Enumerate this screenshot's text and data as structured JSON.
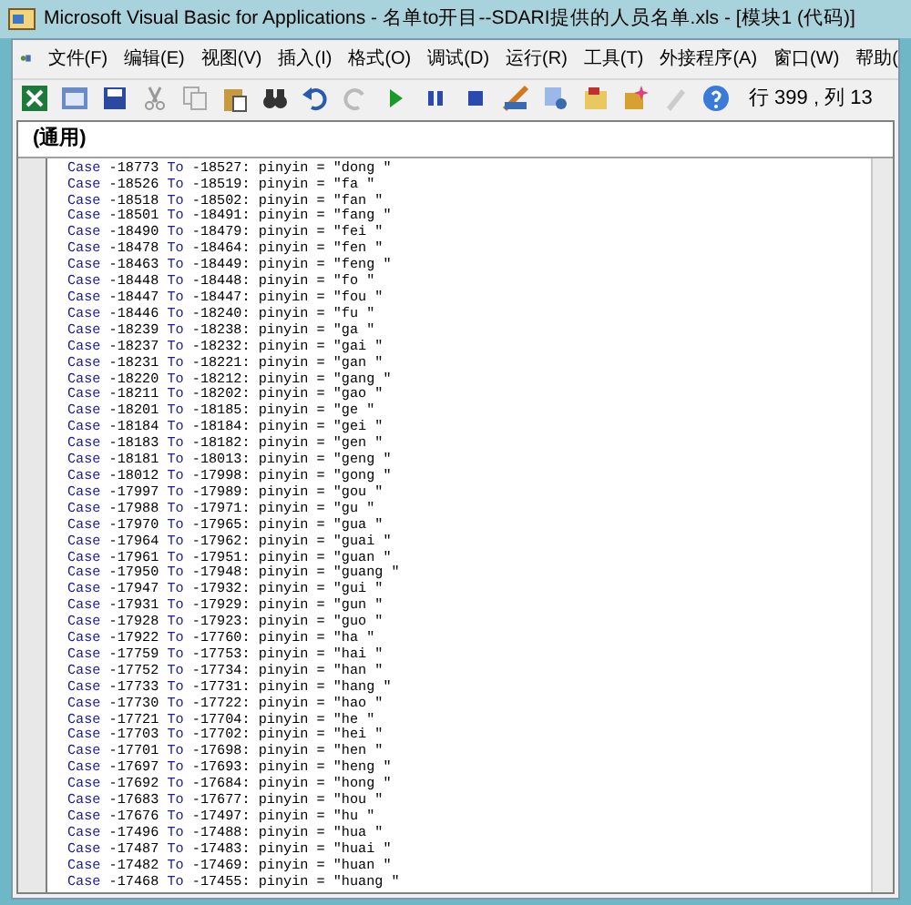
{
  "window": {
    "title": "Microsoft Visual Basic for Applications - 名单to开目--SDARI提供的人员名单.xls - [模块1 (代码)]"
  },
  "menu": [
    "文件(F)",
    "编辑(E)",
    "视图(V)",
    "插入(I)",
    "格式(O)",
    "调试(D)",
    "运行(R)",
    "工具(T)",
    "外接程序(A)",
    "窗口(W)",
    "帮助("
  ],
  "toolbar": {
    "position": "行 399 , 列 13"
  },
  "object_dropdown": {
    "value": "(通用)"
  },
  "code_lines": [
    {
      "keyword": "Case",
      "from": "-18773",
      "keyword_2": "To",
      "to": "-18527:",
      "rest": "pinyin = \"dong \""
    },
    {
      "keyword": "Case",
      "from": "-18526",
      "keyword_2": "To",
      "to": "-18519:",
      "rest": "pinyin = \"fa \""
    },
    {
      "keyword": "Case",
      "from": "-18518",
      "keyword_2": "To",
      "to": "-18502:",
      "rest": "pinyin = \"fan \""
    },
    {
      "keyword": "Case",
      "from": "-18501",
      "keyword_2": "To",
      "to": "-18491:",
      "rest": "pinyin = \"fang \""
    },
    {
      "keyword": "Case",
      "from": "-18490",
      "keyword_2": "To",
      "to": "-18479:",
      "rest": "pinyin = \"fei \""
    },
    {
      "keyword": "Case",
      "from": "-18478",
      "keyword_2": "To",
      "to": "-18464:",
      "rest": "pinyin = \"fen \""
    },
    {
      "keyword": "Case",
      "from": "-18463",
      "keyword_2": "To",
      "to": "-18449:",
      "rest": "pinyin = \"feng \""
    },
    {
      "keyword": "Case",
      "from": "-18448",
      "keyword_2": "To",
      "to": "-18448:",
      "rest": "pinyin = \"fo \""
    },
    {
      "keyword": "Case",
      "from": "-18447",
      "keyword_2": "To",
      "to": "-18447:",
      "rest": "pinyin = \"fou \""
    },
    {
      "keyword": "Case",
      "from": "-18446",
      "keyword_2": "To",
      "to": "-18240:",
      "rest": "pinyin = \"fu \""
    },
    {
      "keyword": "Case",
      "from": "-18239",
      "keyword_2": "To",
      "to": "-18238:",
      "rest": "pinyin = \"ga \""
    },
    {
      "keyword": "Case",
      "from": "-18237",
      "keyword_2": "To",
      "to": "-18232:",
      "rest": "pinyin = \"gai \""
    },
    {
      "keyword": "Case",
      "from": "-18231",
      "keyword_2": "To",
      "to": "-18221:",
      "rest": "pinyin = \"gan \""
    },
    {
      "keyword": "Case",
      "from": "-18220",
      "keyword_2": "To",
      "to": "-18212:",
      "rest": "pinyin = \"gang \""
    },
    {
      "keyword": "Case",
      "from": "-18211",
      "keyword_2": "To",
      "to": "-18202:",
      "rest": "pinyin = \"gao \""
    },
    {
      "keyword": "Case",
      "from": "-18201",
      "keyword_2": "To",
      "to": "-18185:",
      "rest": "pinyin = \"ge \""
    },
    {
      "keyword": "Case",
      "from": "-18184",
      "keyword_2": "To",
      "to": "-18184:",
      "rest": "pinyin = \"gei \""
    },
    {
      "keyword": "Case",
      "from": "-18183",
      "keyword_2": "To",
      "to": "-18182:",
      "rest": "pinyin = \"gen \""
    },
    {
      "keyword": "Case",
      "from": "-18181",
      "keyword_2": "To",
      "to": "-18013:",
      "rest": "pinyin = \"geng \""
    },
    {
      "keyword": "Case",
      "from": "-18012",
      "keyword_2": "To",
      "to": "-17998:",
      "rest": "pinyin = \"gong \""
    },
    {
      "keyword": "Case",
      "from": "-17997",
      "keyword_2": "To",
      "to": "-17989:",
      "rest": "pinyin = \"gou \""
    },
    {
      "keyword": "Case",
      "from": "-17988",
      "keyword_2": "To",
      "to": "-17971:",
      "rest": "pinyin = \"gu \""
    },
    {
      "keyword": "Case",
      "from": "-17970",
      "keyword_2": "To",
      "to": "-17965:",
      "rest": "pinyin = \"gua \""
    },
    {
      "keyword": "Case",
      "from": "-17964",
      "keyword_2": "To",
      "to": "-17962:",
      "rest": "pinyin = \"guai \""
    },
    {
      "keyword": "Case",
      "from": "-17961",
      "keyword_2": "To",
      "to": "-17951:",
      "rest": "pinyin = \"guan \""
    },
    {
      "keyword": "Case",
      "from": "-17950",
      "keyword_2": "To",
      "to": "-17948:",
      "rest": "pinyin = \"guang \""
    },
    {
      "keyword": "Case",
      "from": "-17947",
      "keyword_2": "To",
      "to": "-17932:",
      "rest": "pinyin = \"gui \""
    },
    {
      "keyword": "Case",
      "from": "-17931",
      "keyword_2": "To",
      "to": "-17929:",
      "rest": "pinyin = \"gun \""
    },
    {
      "keyword": "Case",
      "from": "-17928",
      "keyword_2": "To",
      "to": "-17923:",
      "rest": "pinyin = \"guo \""
    },
    {
      "keyword": "Case",
      "from": "-17922",
      "keyword_2": "To",
      "to": "-17760:",
      "rest": "pinyin = \"ha \""
    },
    {
      "keyword": "Case",
      "from": "-17759",
      "keyword_2": "To",
      "to": "-17753:",
      "rest": "pinyin = \"hai \""
    },
    {
      "keyword": "Case",
      "from": "-17752",
      "keyword_2": "To",
      "to": "-17734:",
      "rest": "pinyin = \"han \""
    },
    {
      "keyword": "Case",
      "from": "-17733",
      "keyword_2": "To",
      "to": "-17731:",
      "rest": "pinyin = \"hang \""
    },
    {
      "keyword": "Case",
      "from": "-17730",
      "keyword_2": "To",
      "to": "-17722:",
      "rest": "pinyin = \"hao \""
    },
    {
      "keyword": "Case",
      "from": "-17721",
      "keyword_2": "To",
      "to": "-17704:",
      "rest": "pinyin = \"he \""
    },
    {
      "keyword": "Case",
      "from": "-17703",
      "keyword_2": "To",
      "to": "-17702:",
      "rest": "pinyin = \"hei \""
    },
    {
      "keyword": "Case",
      "from": "-17701",
      "keyword_2": "To",
      "to": "-17698:",
      "rest": "pinyin = \"hen \""
    },
    {
      "keyword": "Case",
      "from": "-17697",
      "keyword_2": "To",
      "to": "-17693:",
      "rest": "pinyin = \"heng \""
    },
    {
      "keyword": "Case",
      "from": "-17692",
      "keyword_2": "To",
      "to": "-17684:",
      "rest": "pinyin = \"hong \""
    },
    {
      "keyword": "Case",
      "from": "-17683",
      "keyword_2": "To",
      "to": "-17677:",
      "rest": "pinyin = \"hou \""
    },
    {
      "keyword": "Case",
      "from": "-17676",
      "keyword_2": "To",
      "to": "-17497:",
      "rest": "pinyin = \"hu \""
    },
    {
      "keyword": "Case",
      "from": "-17496",
      "keyword_2": "To",
      "to": "-17488:",
      "rest": "pinyin = \"hua \""
    },
    {
      "keyword": "Case",
      "from": "-17487",
      "keyword_2": "To",
      "to": "-17483:",
      "rest": "pinyin = \"huai \""
    },
    {
      "keyword": "Case",
      "from": "-17482",
      "keyword_2": "To",
      "to": "-17469:",
      "rest": "pinyin = \"huan \""
    },
    {
      "keyword": "Case",
      "from": "-17468",
      "keyword_2": "To",
      "to": "-17455:",
      "rest": "pinyin = \"huang \""
    }
  ]
}
